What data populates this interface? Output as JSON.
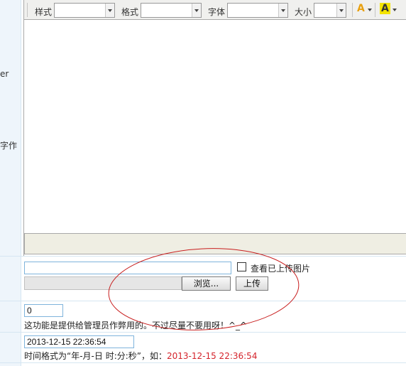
{
  "left_labels": [
    "er",
    "字作"
  ],
  "toolbar": {
    "style_label": "样式",
    "format_label": "格式",
    "font_label": "字体",
    "size_label": "大小",
    "style_value": "",
    "format_value": "",
    "font_value": "",
    "size_value": "",
    "font_color_icon": "A",
    "highlight_icon": "A",
    "font_color": "#e8a010",
    "highlight_color": "#f3e300"
  },
  "upload": {
    "path_value": "",
    "view_uploaded_label": "查看已上传图片",
    "browse_label": "浏览...",
    "upload_label": "上传"
  },
  "counter": {
    "value": "0",
    "hint": "这功能是提供给管理员作弊用的。不过尽量不要用呀！^_^"
  },
  "datetime": {
    "value": "2013-12-15 22:36:54",
    "hint_prefix": "时间格式为“年-月-日 时:分:秒”，如：",
    "hint_example": "2013-12-15 22:36:54"
  },
  "annotation": {
    "color": "#c81e1e"
  }
}
